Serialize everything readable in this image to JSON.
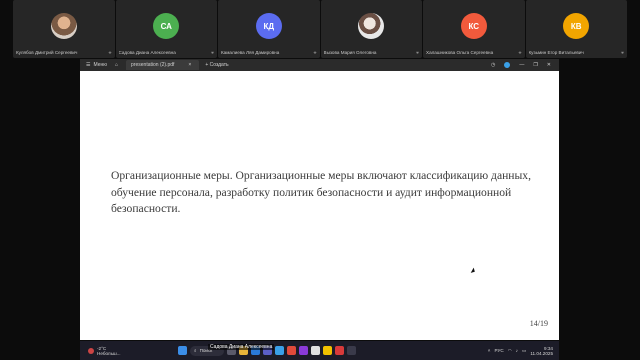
{
  "participants": [
    {
      "name": "Кулябов Дмитрий Сергеевич",
      "initials": "",
      "color": "",
      "photo": "photo1"
    },
    {
      "name": "Садова Диана Алексеевна",
      "initials": "СА",
      "color": "#4caf50"
    },
    {
      "name": "Камалиева Ляя Дамировна",
      "initials": "КД",
      "color": "#5b6cf0"
    },
    {
      "name": "Вызова Мария Олеговна",
      "initials": "",
      "color": "",
      "photo": "photo2"
    },
    {
      "name": "Халашникова Ольга Сергеевна",
      "initials": "КС",
      "color": "#f25a3c"
    },
    {
      "name": "Кузьмин Егор Витальевич",
      "initials": "КВ",
      "color": "#f2a500"
    }
  ],
  "viewer": {
    "menu_label": "Меню",
    "tab_title": "presentation (2).pdf",
    "create_label": "+ Создать"
  },
  "document": {
    "paragraph": "Организационные меры. Организационные меры включают классификацию данных, обучение персонала, разработку политик безопасности и аудит информационной безопасности.",
    "page_indicator": "14/19"
  },
  "taskbar": {
    "temperature": "-2°C",
    "weather": "Небольш...",
    "search_label": "Поиск",
    "speaking_label": "Садова Диана Алексеевна",
    "language": "РУС",
    "time": "9:34",
    "date": "11.04.2025"
  }
}
